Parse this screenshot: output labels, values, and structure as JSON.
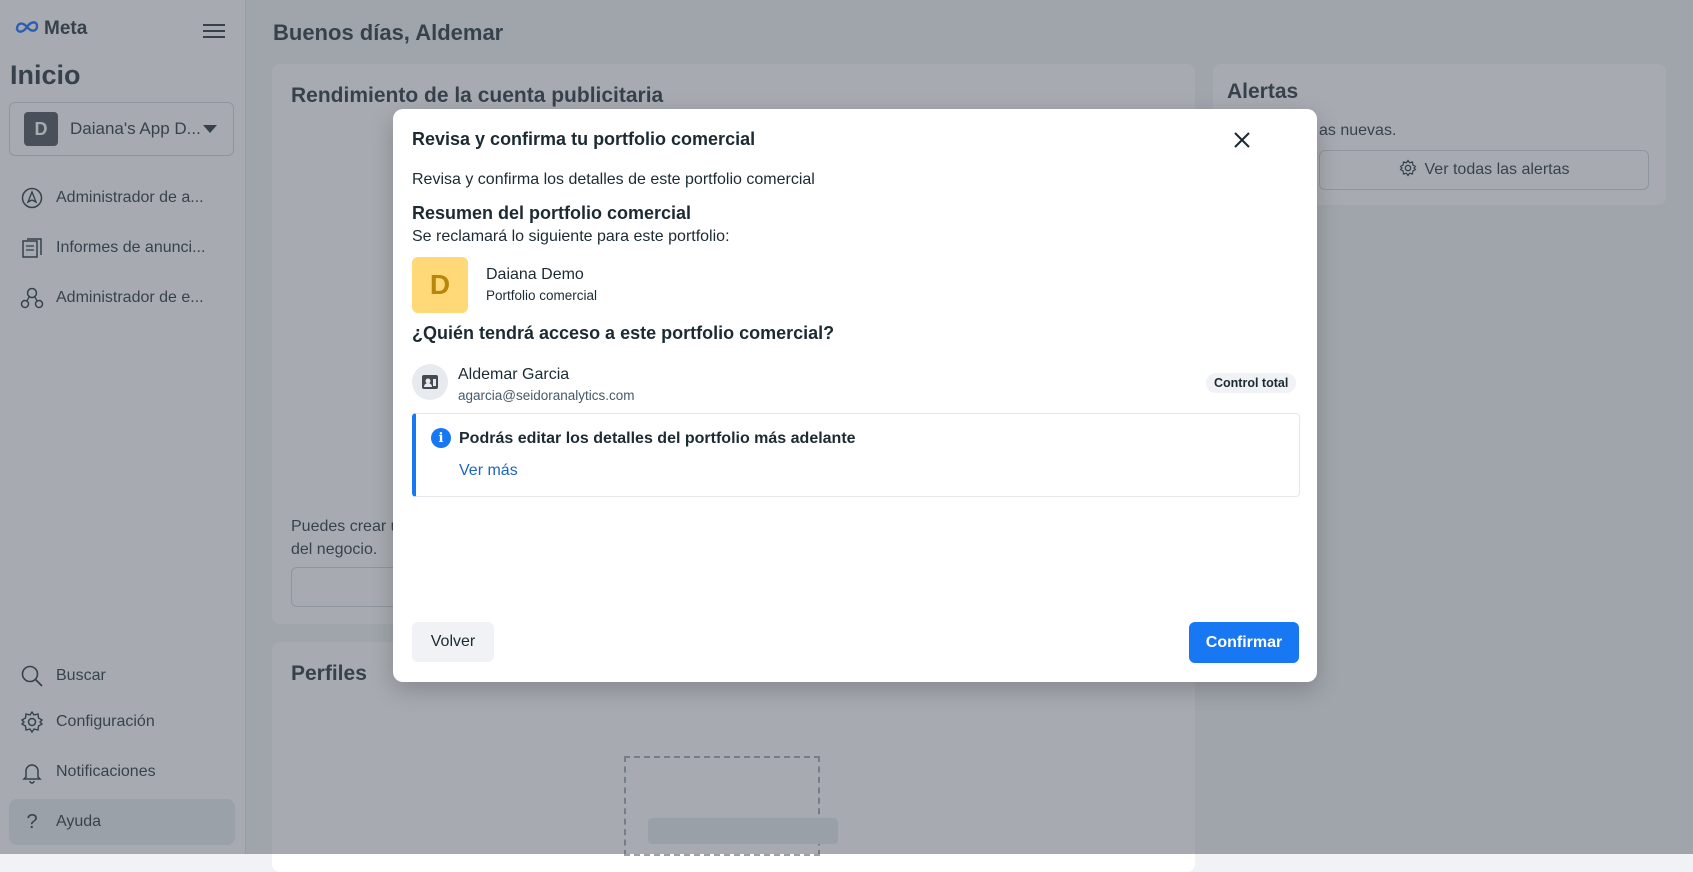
{
  "brand": {
    "name": "Meta"
  },
  "sidebar": {
    "title": "Inicio",
    "account": {
      "initial": "D",
      "name": "Daiana's App D..."
    },
    "items": [
      {
        "label": "Administrador de a...",
        "icon": "navigation-arrow-icon"
      },
      {
        "label": "Informes de anunci...",
        "icon": "report-icon"
      },
      {
        "label": "Administrador de e...",
        "icon": "people-network-icon"
      }
    ],
    "bottom_items": [
      {
        "label": "Buscar",
        "icon": "search-icon"
      },
      {
        "label": "Configuración",
        "icon": "gear-icon"
      },
      {
        "label": "Notificaciones",
        "icon": "bell-icon"
      },
      {
        "label": "Ayuda",
        "icon": "question-icon"
      }
    ]
  },
  "main": {
    "greeting": "Buenos días, Aldemar",
    "performance": {
      "title": "Rendimiento de la cuenta publicitaria",
      "text_line1": "Puedes crear u",
      "text_line2": "del negocio."
    },
    "profiles": {
      "title": "Perfiles"
    },
    "alerts": {
      "title": "Alertas",
      "text": "as nuevas.",
      "button": "Ver todas las alertas"
    }
  },
  "modal": {
    "title": "Revisa y confirma tu portfolio comercial",
    "description": "Revisa y confirma los detalles de este portfolio comercial",
    "summary_heading": "Resumen del portfolio comercial",
    "summary_sub": "Se reclamará lo siguiente para este portfolio:",
    "business": {
      "initial": "D",
      "name": "Daiana Demo",
      "type": "Portfolio comercial"
    },
    "access_heading": "¿Quién tendrá acceso a este portfolio comercial?",
    "user": {
      "name": "Aldemar Garcia",
      "email": "agarcia@seidoranalytics.com",
      "role": "Control total"
    },
    "info": {
      "title": "Podrás editar los detalles del portfolio más adelante",
      "link": "Ver más"
    },
    "buttons": {
      "back": "Volver",
      "confirm": "Confirmar"
    }
  },
  "colors": {
    "accent": "#1877f2",
    "link": "#1d65c1",
    "avatar_yellow": "#ffd978"
  }
}
